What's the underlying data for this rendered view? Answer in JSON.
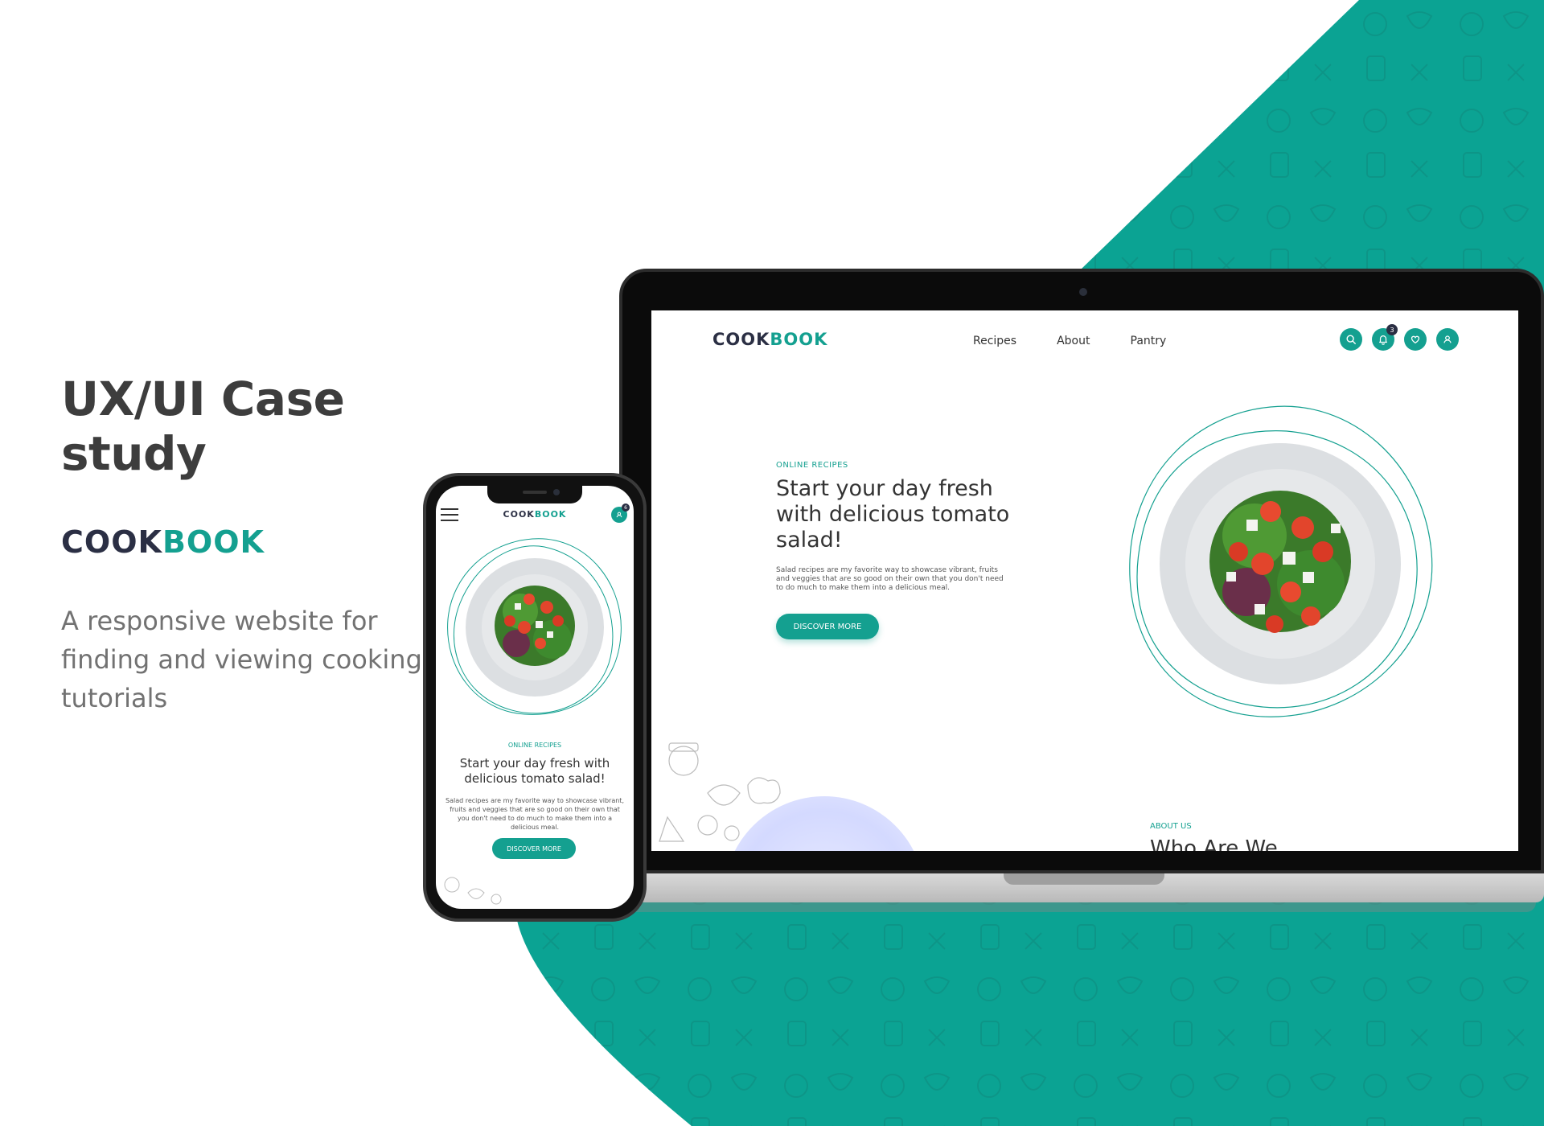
{
  "colors": {
    "accent": "#14a090",
    "brand_dark": "#2b2f44",
    "text": "#333333",
    "muted": "#727272",
    "teal_bg": "#0ba393"
  },
  "intro": {
    "heading": "UX/UI Case study",
    "brand_part1": "COOK",
    "brand_part2": "BOOK",
    "description": "A responsive website for finding and viewing cooking tutorials"
  },
  "desktop_site": {
    "logo_part1": "COOK",
    "logo_part2": "BOOK",
    "nav": [
      "Recipes",
      "About",
      "Pantry"
    ],
    "icons": [
      "search-icon",
      "bell-icon",
      "heart-icon",
      "user-icon"
    ],
    "notification_count": "3",
    "hero": {
      "kicker": "ONLINE RECIPES",
      "title": "Start your day fresh with delicious tomato salad!",
      "description": "Salad recipes are my favorite way to showcase vibrant, fruits and veggies that are so good on their own  that you don't need to do much to make them into a delicious meal.",
      "button": "DISCOVER MORE"
    },
    "about": {
      "kicker": "ABOUT US",
      "title": "Who Are We"
    }
  },
  "mobile_site": {
    "logo_part1": "COOK",
    "logo_part2": "BOOK",
    "notification_count": "6",
    "hero": {
      "kicker": "ONLINE RECIPES",
      "title": "Start your day fresh with delicious tomato salad!",
      "description": "Salad recipes are my favorite way to showcase vibrant, fruits and veggies that are so good on their own  that you don't need to do much to make them into a delicious meal.",
      "button": "DISCOVER MORE"
    }
  }
}
